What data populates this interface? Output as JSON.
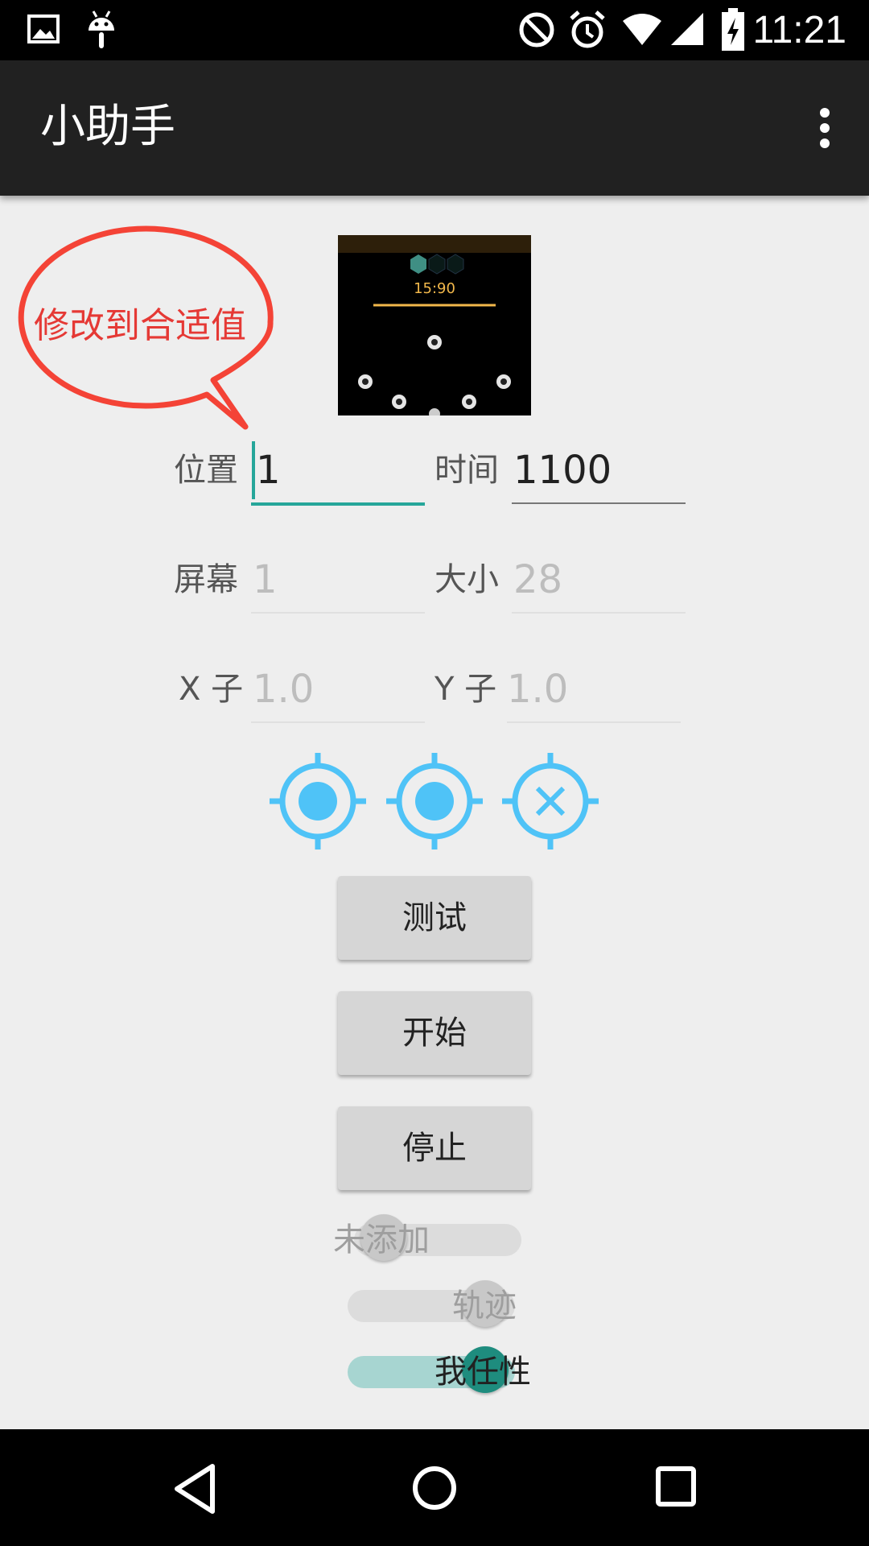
{
  "status_bar": {
    "time": "11:21",
    "left_icons": [
      "image-icon",
      "android-icon"
    ],
    "right_icons": [
      "do-not-disturb-icon",
      "alarm-icon",
      "wifi-icon",
      "signal-icon",
      "battery-charging-icon"
    ]
  },
  "app_bar": {
    "title": "小助手",
    "overflow_icon": "more-vert-icon"
  },
  "annotation": {
    "text": "修改到合适值",
    "color": "#e53935"
  },
  "preview": {
    "timer_text": "15:90"
  },
  "form": {
    "position": {
      "label": "位置",
      "value": "1"
    },
    "time": {
      "label": "时间",
      "value": "1100"
    },
    "screen": {
      "label": "屏幕",
      "placeholder": "1"
    },
    "size": {
      "label": "大小",
      "placeholder": "28"
    },
    "x": {
      "label": "X 子",
      "placeholder": "1.0"
    },
    "y": {
      "label": "Y 子",
      "placeholder": "1.0"
    }
  },
  "targets": [
    {
      "icon": "gps-fixed-icon"
    },
    {
      "icon": "gps-fixed-icon"
    },
    {
      "icon": "gps-cancel-icon"
    }
  ],
  "buttons": {
    "test": "测试",
    "start": "开始",
    "stop": "停止"
  },
  "switches": [
    {
      "label": "未添加",
      "on": false
    },
    {
      "label": "轨迹",
      "on": false
    },
    {
      "label": "我任性",
      "on": true
    }
  ],
  "colors": {
    "accent": "#26a69a",
    "target_blue": "#4fc3f7",
    "app_bar": "#212121"
  },
  "nav_bar": {
    "icons": [
      "back-icon",
      "home-icon",
      "recents-icon"
    ]
  }
}
